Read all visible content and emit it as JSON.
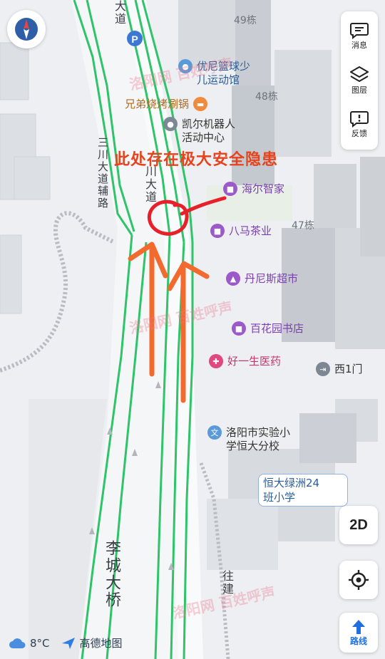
{
  "map": {
    "road_labels": {
      "top_road": "大道",
      "aux_road": "三川大道辅路",
      "main_road": "川大道",
      "bridge": "李城大桥",
      "bottom_road": "往建"
    },
    "building_labels": [
      "49栋",
      "48栋",
      "47栋"
    ],
    "pois": [
      {
        "name": "优尼篮球少儿运动馆",
        "line1": "优尼篮球少",
        "line2": "儿运动馆",
        "style": "blue",
        "icon": "sports-icon"
      },
      {
        "name": "兄弟烧烤涮锅",
        "style": "orange",
        "icon": "restaurant-icon"
      },
      {
        "name": "凯尔机器人活动中心",
        "line1": "凯尔机器人",
        "line2": "活动中心",
        "style": "grey",
        "icon": "location-icon"
      },
      {
        "name": "海尔智家",
        "style": "purple",
        "icon": "shop-icon"
      },
      {
        "name": "八马茶业",
        "style": "purple",
        "icon": "shop-icon"
      },
      {
        "name": "丹尼斯超市",
        "style": "purple",
        "icon": "shopping-bag-icon"
      },
      {
        "name": "百花园书店",
        "style": "purple",
        "icon": "shop-icon"
      },
      {
        "name": "好一生医药",
        "style": "pink",
        "icon": "pharmacy-icon"
      },
      {
        "name": "西1门",
        "style": "grey",
        "icon": "gate-icon"
      },
      {
        "name": "洛阳市实验小学恒大分校",
        "line1": "洛阳市实验小",
        "line2": "学恒大分校",
        "style": "blue",
        "icon": "school-icon"
      }
    ],
    "school_card": {
      "line1": "恒大绿洲24",
      "line2": "班小学"
    },
    "parking": "P"
  },
  "annotation": {
    "text": "此处存在极大安全隐患",
    "color": "#e8421c"
  },
  "watermark": "洛阳网 百姓呼声",
  "toolbar": {
    "message_label": "消息",
    "layers_label": "图层",
    "feedback_label": "反馈",
    "view_mode": "2D",
    "route_label": "路线"
  },
  "status": {
    "temperature": "8°C",
    "weather_icon": "cloud-icon",
    "brand": "高德地图"
  },
  "colors": {
    "road_green": "#2fc36a",
    "annotation_red": "#e8421c",
    "arrow_orange": "#f26a2e",
    "route_blue": "#1f6fe0"
  }
}
